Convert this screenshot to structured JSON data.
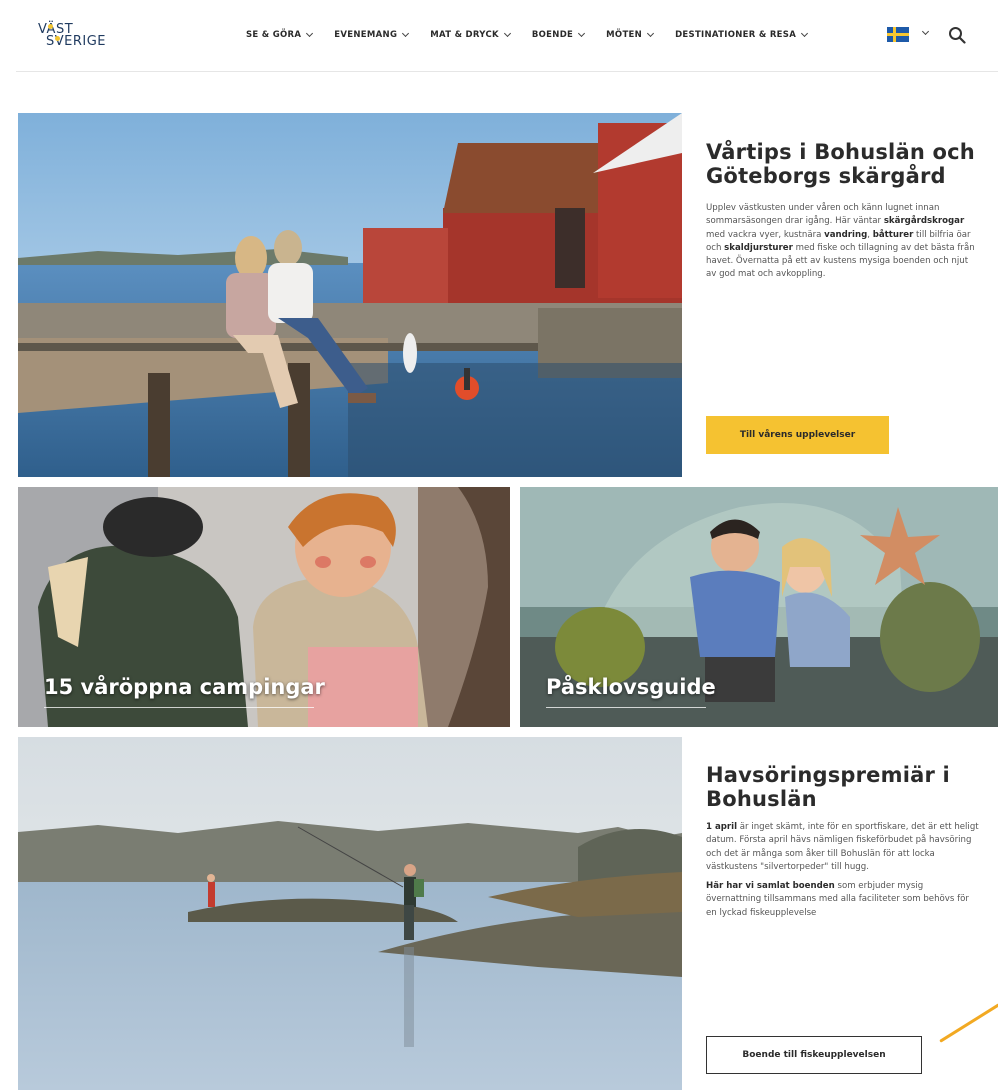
{
  "header": {
    "logo_line1": "VÄST",
    "logo_line2": "SVERIGE",
    "nav": [
      "SE & GÖRA",
      "EVENEMANG",
      "MAT & DRYCK",
      "BOENDE",
      "MÖTEN",
      "DESTINATIONER & RESA"
    ],
    "language_icon": "swedish-flag-icon",
    "search_icon": "search-icon"
  },
  "feature1": {
    "title_line1": "Vårtips i Bohuslän och",
    "title_line2": "Göteborgs skärgård",
    "body": [
      {
        "t": "Upplev västkusten under våren och känn lugnet innan sommarsäsongen drar igång. Här väntar ",
        "b": false
      },
      {
        "t": "skärgårdskrogar",
        "b": true
      },
      {
        "t": " med vackra vyer, kustnära ",
        "b": false
      },
      {
        "t": "vandring",
        "b": true
      },
      {
        "t": ", ",
        "b": false
      },
      {
        "t": "båtturer",
        "b": true
      },
      {
        "t": " till bilfria öar och ",
        "b": false
      },
      {
        "t": "skaldjursturer",
        "b": true
      },
      {
        "t": " med fiske och tillagning av det bästa från havet. Övernatta på ett av kustens mysiga boenden och njut av god mat och avkoppling.",
        "b": false
      }
    ],
    "button": "Till vårens upplevelser"
  },
  "tiles": [
    {
      "caption": "15 våröppna campingar"
    },
    {
      "caption": "Påsklovsguide"
    }
  ],
  "feature2": {
    "title_line1": "Havsöringspremiär i",
    "title_line2": "Bohuslän",
    "para1": [
      {
        "t": "1 april",
        "b": true
      },
      {
        "t": " är inget skämt, inte för en sportfiskare, det är ett heligt datum. Första april hävs nämligen fiskeförbudet på havsöring och det är många som åker till Bohuslän för att locka västkustens \"silvertorpeder\" till hugg.",
        "b": false
      }
    ],
    "para2": [
      {
        "t": "Här har vi samlat boenden",
        "b": true
      },
      {
        "t": " som erbjuder mysig övernattning tillsammans med alla faciliteter som behövs för en lyckad fiskeupplevelse",
        "b": false
      }
    ],
    "button": "Boende till fiskeupplevelsen"
  },
  "colors": {
    "accent_yellow": "#f5c231",
    "logo_blue": "#1f3a5f",
    "text_dark": "#2b2b2b",
    "flag_blue": "#1e5aa8",
    "flag_yellow": "#f7c62f",
    "annotation_stroke": "#f2a922"
  }
}
